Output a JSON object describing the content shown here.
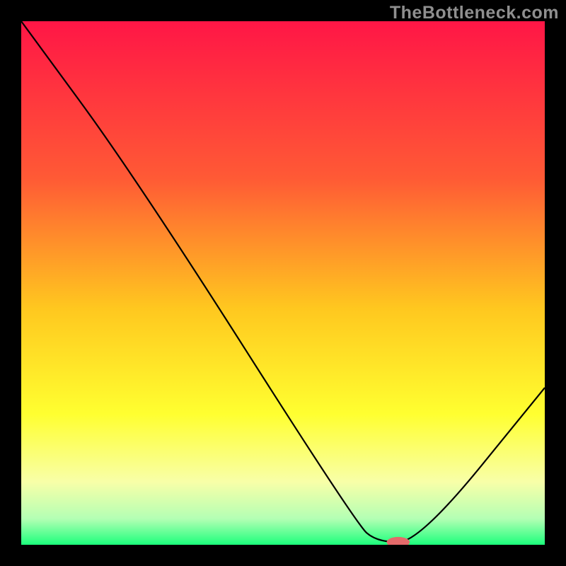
{
  "watermark": "TheBottleneck.com",
  "chart_data": {
    "type": "line",
    "title": "",
    "xlabel": "",
    "ylabel": "",
    "xlim": [
      0,
      100
    ],
    "ylim": [
      0,
      100
    ],
    "grid": false,
    "background_gradient": {
      "stops": [
        {
          "offset": 0.0,
          "color": "#ff1646"
        },
        {
          "offset": 0.3,
          "color": "#ff5a35"
        },
        {
          "offset": 0.55,
          "color": "#ffc81f"
        },
        {
          "offset": 0.75,
          "color": "#ffff30"
        },
        {
          "offset": 0.88,
          "color": "#f8ffa8"
        },
        {
          "offset": 0.95,
          "color": "#b4ffb4"
        },
        {
          "offset": 1.0,
          "color": "#1cff7c"
        }
      ]
    },
    "curve": [
      {
        "x": 0.0,
        "y": 100.0
      },
      {
        "x": 22.0,
        "y": 70.0
      },
      {
        "x": 64.0,
        "y": 4.0
      },
      {
        "x": 68.0,
        "y": 0.5
      },
      {
        "x": 76.0,
        "y": 0.5
      },
      {
        "x": 100.0,
        "y": 30.0
      }
    ],
    "marker": {
      "x": 72.0,
      "y": 0.5,
      "color": "#e46a6a",
      "rx_pct": 2.2,
      "ry_pct": 1.0
    }
  }
}
